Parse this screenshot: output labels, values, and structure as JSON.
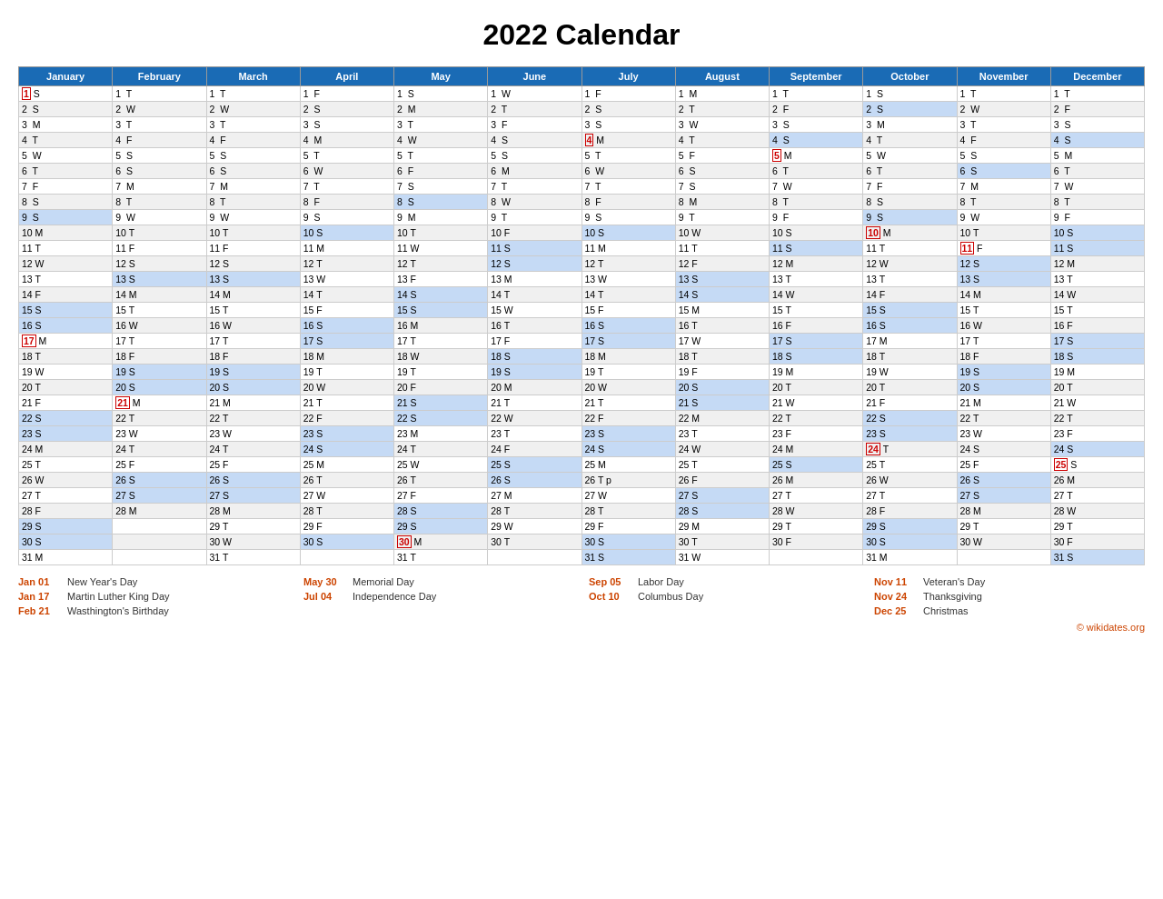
{
  "title": "2022 Calendar",
  "months": [
    "January",
    "February",
    "March",
    "April",
    "May",
    "June",
    "July",
    "August",
    "September",
    "October",
    "November",
    "December"
  ],
  "holidays": [
    {
      "date": "Jan 01",
      "name": "New Year's Day"
    },
    {
      "date": "Jan 17",
      "name": "Martin Luther King Day"
    },
    {
      "date": "Feb 21",
      "name": "Wasthington's Birthday"
    },
    {
      "date": "May 30",
      "name": "Memorial Day"
    },
    {
      "date": "Jul 04",
      "name": "Independence Day"
    },
    {
      "date": "Sep 05",
      "name": "Labor Day"
    },
    {
      "date": "Oct 10",
      "name": "Columbus Day"
    },
    {
      "date": "Nov 11",
      "name": "Veteran's Day"
    },
    {
      "date": "Nov 24",
      "name": "Thanksgiving"
    },
    {
      "date": "Dec 25",
      "name": "Christmas"
    }
  ],
  "footer_credit": "© wikidates.org"
}
